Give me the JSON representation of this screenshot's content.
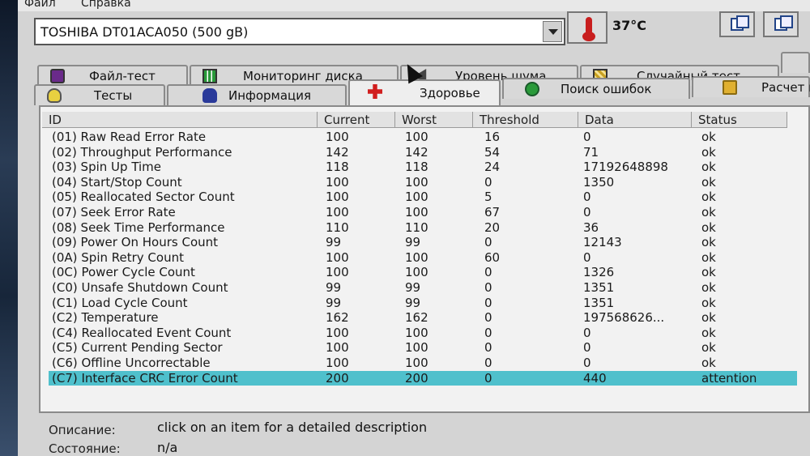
{
  "menu": {
    "items": [
      "Файл",
      "Справка"
    ]
  },
  "toolbar": {
    "device": "TOSHIBA DT01ACA050 (500 gB)",
    "temperature": "37°C"
  },
  "tabs_back": [
    {
      "label": "Файл-тест",
      "icon": "file-test-icon"
    },
    {
      "label": "Мониторинг диска",
      "icon": "monitor-chart-icon"
    },
    {
      "label": "Уровень шума",
      "icon": "speaker-icon"
    },
    {
      "label": "Случайный тест",
      "icon": "random-test-icon"
    }
  ],
  "tabs_front": [
    {
      "label": "Тесты",
      "icon": "lightbulb-icon"
    },
    {
      "label": "Информация",
      "icon": "info-person-icon"
    },
    {
      "label": "Здоровье",
      "icon": "health-cross-icon"
    },
    {
      "label": "Поиск ошибок",
      "icon": "magnifier-icon"
    },
    {
      "label": "Расчет п",
      "icon": "folder-icon"
    }
  ],
  "table": {
    "columns": [
      "ID",
      "Current",
      "Worst",
      "Threshold",
      "Data",
      "Status"
    ],
    "rows": [
      [
        "(01) Raw Read Error Rate",
        "100",
        "100",
        "16",
        "0",
        "ok"
      ],
      [
        "(02) Throughput Performance",
        "142",
        "142",
        "54",
        "71",
        "ok"
      ],
      [
        "(03) Spin Up Time",
        "118",
        "118",
        "24",
        "17192648898",
        "ok"
      ],
      [
        "(04) Start/Stop Count",
        "100",
        "100",
        "0",
        "1350",
        "ok"
      ],
      [
        "(05) Reallocated Sector Count",
        "100",
        "100",
        "5",
        "0",
        "ok"
      ],
      [
        "(07) Seek Error Rate",
        "100",
        "100",
        "67",
        "0",
        "ok"
      ],
      [
        "(08) Seek Time Performance",
        "110",
        "110",
        "20",
        "36",
        "ok"
      ],
      [
        "(09) Power On Hours Count",
        "99",
        "99",
        "0",
        "12143",
        "ok"
      ],
      [
        "(0A) Spin Retry Count",
        "100",
        "100",
        "60",
        "0",
        "ok"
      ],
      [
        "(0C) Power Cycle Count",
        "100",
        "100",
        "0",
        "1326",
        "ok"
      ],
      [
        "(C0) Unsafe Shutdown Count",
        "99",
        "99",
        "0",
        "1351",
        "ok"
      ],
      [
        "(C1) Load Cycle Count",
        "99",
        "99",
        "0",
        "1351",
        "ok"
      ],
      [
        "(C2) Temperature",
        "162",
        "162",
        "0",
        "197568626...",
        "ok"
      ],
      [
        "(C4) Reallocated Event Count",
        "100",
        "100",
        "0",
        "0",
        "ok"
      ],
      [
        "(C5) Current Pending Sector",
        "100",
        "100",
        "0",
        "0",
        "ok"
      ],
      [
        "(C6) Offline Uncorrectable",
        "100",
        "100",
        "0",
        "0",
        "ok"
      ],
      [
        "(C7) Interface CRC Error Count",
        "200",
        "200",
        "0",
        "440",
        "attention"
      ]
    ],
    "selected_row": 16,
    "selected_color": "#4fc0cc"
  },
  "details": {
    "description_label": "Описание:",
    "description_value": "click on an item for a detailed description",
    "state_label": "Состояние:",
    "state_value": "n/a"
  }
}
